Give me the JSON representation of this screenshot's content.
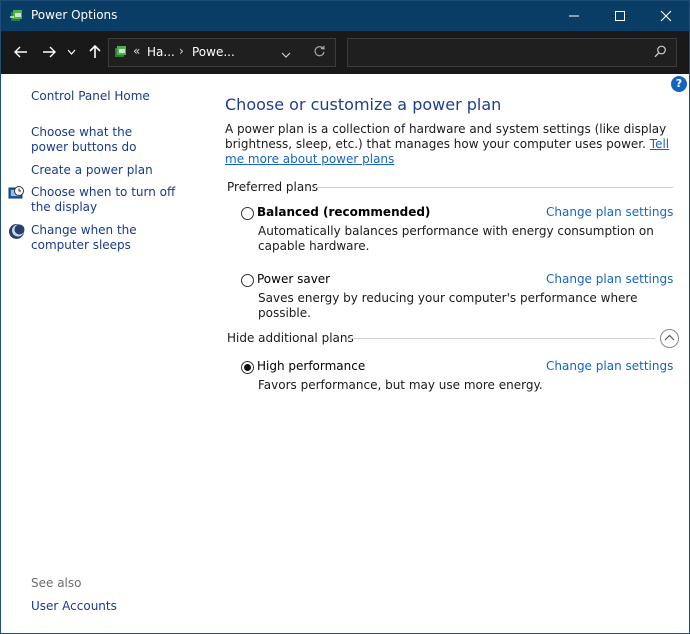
{
  "window": {
    "title": "Power Options",
    "app_icon": "power-options-icon"
  },
  "address_bar": {
    "overflow": "«",
    "segments": [
      "Ha...",
      "Powe..."
    ],
    "search_placeholder": ""
  },
  "left_nav": {
    "home": "Control Panel Home",
    "links": [
      {
        "label": "Choose what the power buttons do",
        "icon": null
      },
      {
        "label": "Create a power plan",
        "icon": null
      },
      {
        "label": "Choose when to turn off the display",
        "icon": "display-clock-icon"
      },
      {
        "label": "Change when the computer sleeps",
        "icon": "sleep-moon-icon"
      }
    ],
    "see_also": "See also",
    "user_accounts": "User Accounts"
  },
  "main": {
    "heading": "Choose or customize a power plan",
    "intro": "A power plan is a collection of hardware and system settings (like display brightness, sleep, etc.) that manages how your computer uses power.",
    "intro_link": "Tell me more about power plans",
    "preferred_label": "Preferred plans",
    "hidden_label": "Hide additional plans",
    "plans": [
      {
        "name": "Balanced (recommended)",
        "description": "Automatically balances performance with energy consumption on capable hardware.",
        "selected": false,
        "change_label": "Change plan settings"
      },
      {
        "name": "Power saver",
        "description": "Saves energy by reducing your computer's performance where possible.",
        "selected": false,
        "change_label": "Change plan settings"
      },
      {
        "name": "High performance",
        "description": "Favors performance, but may use more energy.",
        "selected": true,
        "change_label": "Change plan settings"
      }
    ]
  },
  "colors": {
    "titlebar": "#0a3d66",
    "link": "#1565c0",
    "heading": "#1e3f8c",
    "nav_link": "#1a3a8a"
  }
}
